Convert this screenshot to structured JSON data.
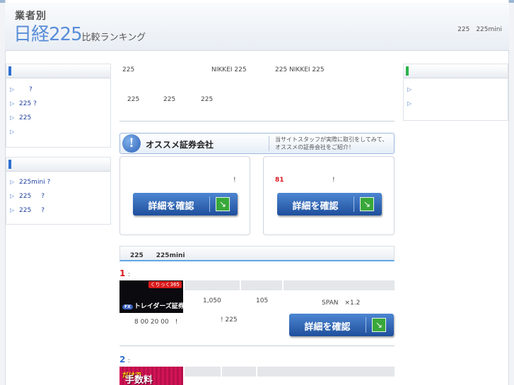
{
  "header": {
    "logo_small": "業者別",
    "logo_big": "日経225",
    "logo_sub": "比較ランキング",
    "right_link": "225　225mini"
  },
  "left_sidebar": {
    "box1": {
      "accent": "#2f6fd1",
      "items": [
        {
          "label": "",
          "suffix": "?"
        },
        {
          "label": "225",
          "suffix": "?"
        },
        {
          "label": "225",
          "suffix": ""
        },
        {
          "label": "",
          "suffix": ""
        }
      ]
    },
    "box2": {
      "accent": "#2f6fd1",
      "items": [
        {
          "label": "225mini",
          "suffix": "?"
        },
        {
          "label": "225",
          "suffix": "?"
        },
        {
          "label": "225",
          "suffix": "?"
        }
      ]
    }
  },
  "right_sidebar": {
    "accent": "#29b34a",
    "items": [
      {
        "label": ""
      },
      {
        "label": ""
      }
    ]
  },
  "intro": {
    "line1_a": "225",
    "line1_b": "NIKKEI 225",
    "line1_c": "225 NIKKEI 225",
    "line2_a": "225",
    "line2_b": "225",
    "line2_c": "225"
  },
  "recommend": {
    "icon": "!",
    "title": "オススメ証券会社",
    "desc": "当サイトスタッフが実際に取引をしてみて、オススメの証券会社をご紹介！"
  },
  "cards": [
    {
      "text": "!",
      "highlight": "",
      "button": "詳細を確認",
      "go_icon": "↘"
    },
    {
      "text": "!",
      "highlight": "81",
      "button": "詳細を確認",
      "go_icon": "↘"
    }
  ],
  "section": {
    "title": "225　　225mini"
  },
  "ranking": [
    {
      "rank": "1",
      "colon": ":",
      "logo_tag": "くりっく365",
      "logo_pill": "FX",
      "logo_name": "トレイダーズ証券",
      "cells": [
        "1,050",
        "105",
        "SPAN　×1.2"
      ],
      "note_a": "8 00 20 00　!",
      "note_b": "! 225",
      "button": "詳細を確認",
      "go_icon": "↘"
    },
    {
      "rank": "2",
      "colon": ":",
      "logo_text": "手数料",
      "logo_small": "だけで"
    }
  ],
  "colors": {
    "rank1": "#d8151b",
    "rank2": "#2f6fd1",
    "link": "#1e3fa0",
    "highlight": "#d8151b"
  }
}
